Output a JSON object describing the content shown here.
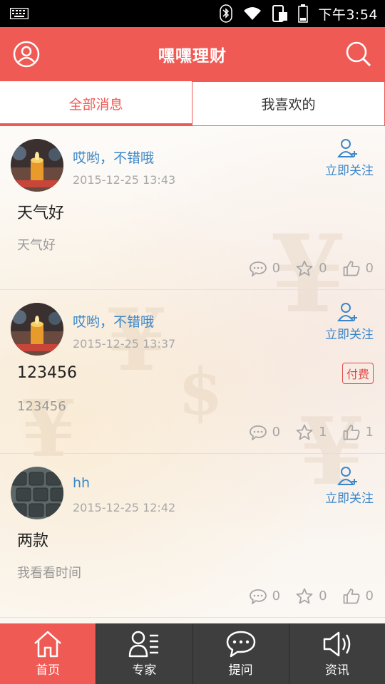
{
  "status_bar": {
    "time": "下午3:54"
  },
  "header": {
    "title": "嘿嘿理财"
  },
  "tabs": [
    {
      "label": "全部消息",
      "active": true
    },
    {
      "label": "我喜欢的",
      "active": false
    }
  ],
  "posts": [
    {
      "username": "哎哟，不错哦",
      "time": "2015-12-25 13:43",
      "follow_label": "立即关注",
      "title": "天气好",
      "body": "天气好",
      "comments": "0",
      "stars": "0",
      "likes": "0",
      "paid_label": ""
    },
    {
      "username": "哎哟，不错哦",
      "time": "2015-12-25 13:37",
      "follow_label": "立即关注",
      "title": "123456",
      "body": "123456",
      "comments": "0",
      "stars": "1",
      "likes": "1",
      "paid_label": "付费"
    },
    {
      "username": "hh",
      "time": "2015-12-25 12:42",
      "follow_label": "立即关注",
      "title": "两款",
      "body": "我看看时间",
      "comments": "0",
      "stars": "0",
      "likes": "0",
      "paid_label": ""
    }
  ],
  "bottom_nav": [
    {
      "label": "首页",
      "icon": "home-icon",
      "active": true
    },
    {
      "label": "专家",
      "icon": "expert-list-icon",
      "active": false
    },
    {
      "label": "提问",
      "icon": "chat-bubble-icon",
      "active": false
    },
    {
      "label": "资讯",
      "icon": "speaker-icon",
      "active": false
    }
  ],
  "colors": {
    "brand": "#f05a55",
    "link": "#3b86c9",
    "nav_bg": "#3e3e3e"
  }
}
